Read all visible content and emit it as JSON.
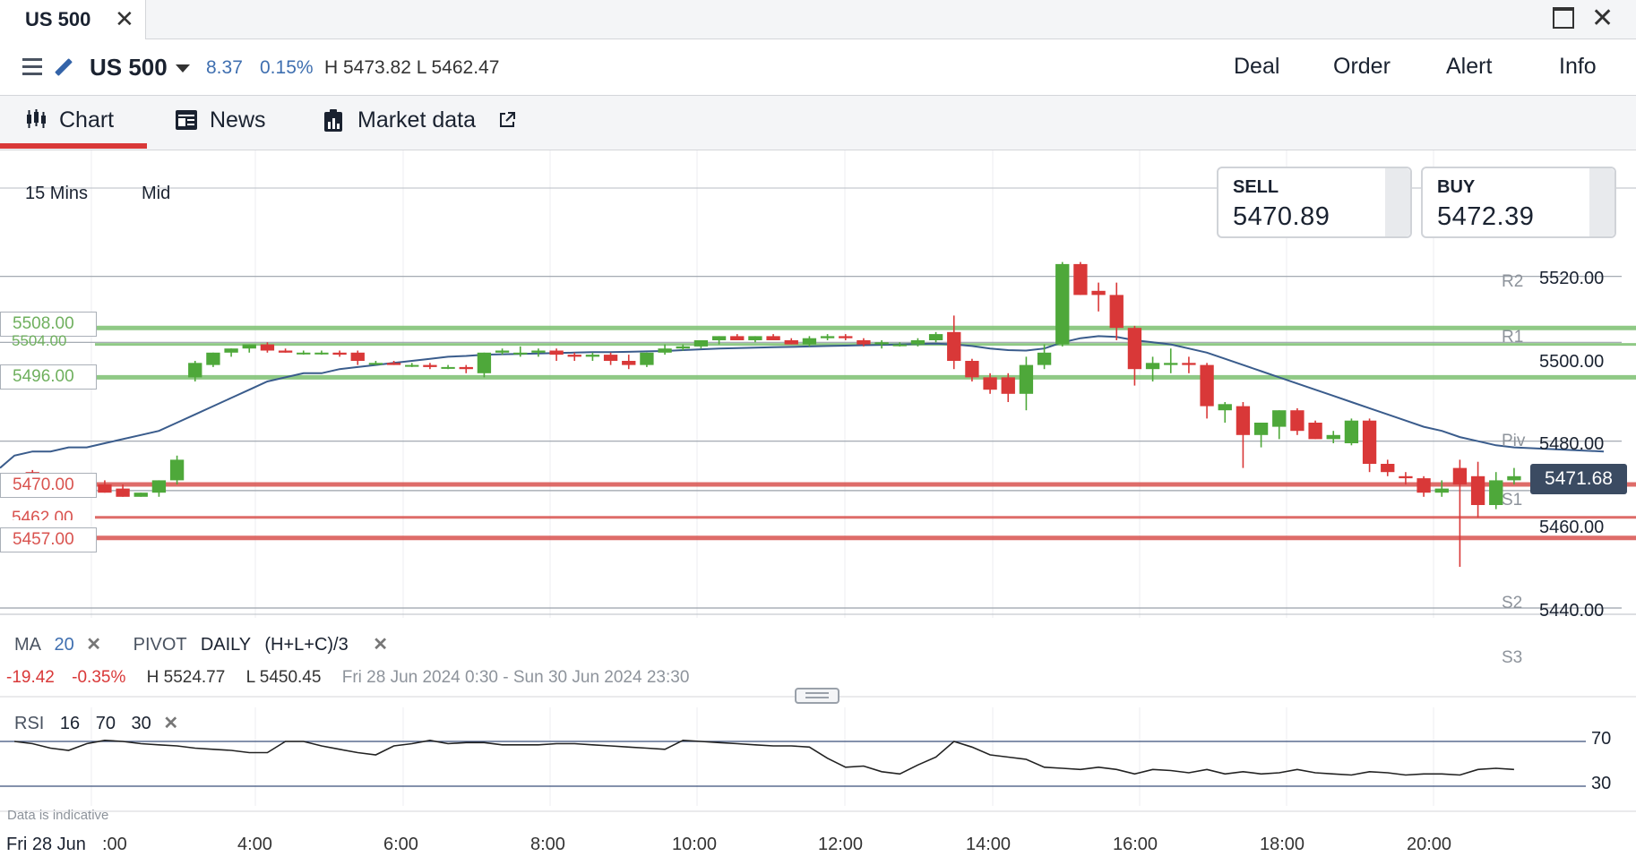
{
  "window": {
    "tab_title": "US 500",
    "close_glyph": "✕",
    "close_win_glyph": "✕"
  },
  "header": {
    "instrument": "US 500",
    "change": "8.37",
    "change_pct": "0.15%",
    "high_low": "H 5473.82  L 5462.47",
    "buttons": [
      "Deal",
      "Order",
      "Alert",
      "Info"
    ]
  },
  "tabs": [
    {
      "label": "Chart",
      "icon": "candlestick-icon",
      "active": true
    },
    {
      "label": "News",
      "icon": "newspaper-icon"
    },
    {
      "label": "Market data",
      "icon": "bar-report-icon",
      "external_icon": "external-link-icon"
    }
  ],
  "chart_controls": {
    "timeframe": "15 Mins",
    "price_type": "Mid"
  },
  "quote": {
    "sell_label": "SELL",
    "sell": "5470.89",
    "buy_label": "BUY",
    "buy": "5472.39",
    "current": "5471.68"
  },
  "levels": {
    "green": [
      "5508.00",
      "5504.00",
      "5496.00"
    ],
    "red": [
      "5470.00",
      "5462.00",
      "5457.00"
    ]
  },
  "pivots": [
    "R2",
    "R1",
    "Piv",
    "S1",
    "S2",
    "S3"
  ],
  "y_axis": [
    "5520.00",
    "5500.00",
    "5480.00",
    "5460.00",
    "5440.00"
  ],
  "studies": {
    "ma_label": "MA",
    "ma_period": "20",
    "ma_remove": "✕",
    "pivot_label": "PIVOT",
    "pivot_period": "DAILY",
    "pivot_formula": "(H+L+C)/3",
    "pivot_remove": "✕"
  },
  "stats": {
    "change": "-19.42",
    "change_pct": "-0.35%",
    "high": "H 5524.77",
    "low": "L 5450.45",
    "range": "Fri 28 Jun 2024 0:30 - Sun 30 Jun 2024 23:30"
  },
  "rsi": {
    "label": "RSI",
    "period": "16",
    "upper": "70",
    "lower": "30",
    "remove": "✕"
  },
  "disclaimer": "Data is indicative",
  "x_axis": {
    "date_label": "Fri 28 Jun",
    "times": [
      ":00",
      "4:00",
      "6:00",
      "8:00",
      "10:00",
      "12:00",
      "14:00",
      "16:00",
      "18:00",
      "20:00"
    ]
  },
  "colors": {
    "up": "#4ea83a",
    "down": "#d93838",
    "ma": "#3a5c8c",
    "rsi": "#222222",
    "support_line": "#d9534f",
    "resistance_line": "#7cc070",
    "accent": "#d93838"
  },
  "chart_data": {
    "type": "candlestick",
    "timeframe": "15 Mins",
    "ylim": [
      5440,
      5530
    ],
    "candles": [
      {
        "o": 5471,
        "h": 5472,
        "l": 5469.5,
        "c": 5472
      },
      {
        "o": 5473,
        "h": 5473.5,
        "l": 5471,
        "c": 5471
      },
      {
        "o": 5471,
        "h": 5472,
        "l": 5470,
        "c": 5471
      },
      {
        "o": 5471,
        "h": 5472,
        "l": 5469,
        "c": 5469
      },
      {
        "o": 5470,
        "h": 5471,
        "l": 5469,
        "c": 5470
      },
      {
        "o": 5470,
        "h": 5471,
        "l": 5468,
        "c": 5468
      },
      {
        "o": 5469,
        "h": 5470,
        "l": 5467,
        "c": 5467
      },
      {
        "o": 5467,
        "h": 5468,
        "l": 5467,
        "c": 5468
      },
      {
        "o": 5468,
        "h": 5471,
        "l": 5467,
        "c": 5471
      },
      {
        "o": 5471,
        "h": 5477,
        "l": 5470,
        "c": 5476
      },
      {
        "o": 5496,
        "h": 5500,
        "l": 5495,
        "c": 5499.5
      },
      {
        "o": 5499,
        "h": 5502,
        "l": 5498.5,
        "c": 5502
      },
      {
        "o": 5502,
        "h": 5503,
        "l": 5501,
        "c": 5503
      },
      {
        "o": 5503,
        "h": 5504,
        "l": 5502,
        "c": 5504
      },
      {
        "o": 5504,
        "h": 5504.5,
        "l": 5502,
        "c": 5502.5
      },
      {
        "o": 5502.5,
        "h": 5503,
        "l": 5502,
        "c": 5502
      },
      {
        "o": 5502,
        "h": 5502.5,
        "l": 5501.5,
        "c": 5502
      },
      {
        "o": 5502,
        "h": 5502.5,
        "l": 5501.5,
        "c": 5502
      },
      {
        "o": 5502,
        "h": 5502.5,
        "l": 5501,
        "c": 5501.5
      },
      {
        "o": 5502,
        "h": 5502.5,
        "l": 5499,
        "c": 5500
      },
      {
        "o": 5499.5,
        "h": 5500,
        "l": 5499,
        "c": 5499.5
      },
      {
        "o": 5499.5,
        "h": 5500,
        "l": 5499,
        "c": 5499
      },
      {
        "o": 5499,
        "h": 5499.5,
        "l": 5498.5,
        "c": 5499
      },
      {
        "o": 5499,
        "h": 5499.5,
        "l": 5498,
        "c": 5498.5
      },
      {
        "o": 5498.5,
        "h": 5499,
        "l": 5498,
        "c": 5498.5
      },
      {
        "o": 5498.5,
        "h": 5499,
        "l": 5497,
        "c": 5498
      },
      {
        "o": 5497,
        "h": 5502,
        "l": 5496,
        "c": 5502
      },
      {
        "o": 5502,
        "h": 5503,
        "l": 5501.5,
        "c": 5502.5
      },
      {
        "o": 5502,
        "h": 5503.5,
        "l": 5501,
        "c": 5502
      },
      {
        "o": 5502,
        "h": 5503,
        "l": 5501,
        "c": 5502.5
      },
      {
        "o": 5502.5,
        "h": 5503,
        "l": 5500,
        "c": 5501.5
      },
      {
        "o": 5501.5,
        "h": 5502,
        "l": 5500,
        "c": 5501
      },
      {
        "o": 5501,
        "h": 5502,
        "l": 5500,
        "c": 5501.5
      },
      {
        "o": 5501.5,
        "h": 5502,
        "l": 5499,
        "c": 5500
      },
      {
        "o": 5500,
        "h": 5501.5,
        "l": 5498,
        "c": 5499
      },
      {
        "o": 5499,
        "h": 5502,
        "l": 5498.5,
        "c": 5502
      },
      {
        "o": 5502,
        "h": 5504,
        "l": 5501.5,
        "c": 5503
      },
      {
        "o": 5503,
        "h": 5504,
        "l": 5502.5,
        "c": 5503.5
      },
      {
        "o": 5503.5,
        "h": 5505,
        "l": 5503,
        "c": 5505
      },
      {
        "o": 5505,
        "h": 5506,
        "l": 5504,
        "c": 5506
      },
      {
        "o": 5506,
        "h": 5506.5,
        "l": 5505,
        "c": 5505
      },
      {
        "o": 5505,
        "h": 5506,
        "l": 5504.5,
        "c": 5506
      },
      {
        "o": 5506,
        "h": 5506.5,
        "l": 5505,
        "c": 5505
      },
      {
        "o": 5505,
        "h": 5505.5,
        "l": 5504,
        "c": 5504
      },
      {
        "o": 5504,
        "h": 5506,
        "l": 5503.5,
        "c": 5505.5
      },
      {
        "o": 5505.5,
        "h": 5506.5,
        "l": 5505,
        "c": 5506
      },
      {
        "o": 5506,
        "h": 5506.5,
        "l": 5505,
        "c": 5505.5
      },
      {
        "o": 5505,
        "h": 5505.5,
        "l": 5503.5,
        "c": 5504
      },
      {
        "o": 5504,
        "h": 5505,
        "l": 5503,
        "c": 5504.5
      },
      {
        "o": 5504,
        "h": 5504.5,
        "l": 5503.5,
        "c": 5504
      },
      {
        "o": 5504,
        "h": 5505.5,
        "l": 5503.5,
        "c": 5505
      },
      {
        "o": 5505,
        "h": 5507,
        "l": 5504.5,
        "c": 5506.5
      },
      {
        "o": 5507,
        "h": 5511,
        "l": 5498,
        "c": 5500
      },
      {
        "o": 5500,
        "h": 5500.5,
        "l": 5495,
        "c": 5496
      },
      {
        "o": 5496,
        "h": 5497,
        "l": 5492,
        "c": 5493
      },
      {
        "o": 5496,
        "h": 5497,
        "l": 5490,
        "c": 5492
      },
      {
        "o": 5492,
        "h": 5501,
        "l": 5488,
        "c": 5499
      },
      {
        "o": 5499,
        "h": 5504,
        "l": 5498,
        "c": 5502
      },
      {
        "o": 5504,
        "h": 5524,
        "l": 5503.5,
        "c": 5523.5
      },
      {
        "o": 5523.5,
        "h": 5524,
        "l": 5516,
        "c": 5516
      },
      {
        "o": 5517,
        "h": 5519,
        "l": 5512,
        "c": 5516
      },
      {
        "o": 5516,
        "h": 5519,
        "l": 5505,
        "c": 5508
      },
      {
        "o": 5508,
        "h": 5508.5,
        "l": 5494,
        "c": 5498
      },
      {
        "o": 5498,
        "h": 5501,
        "l": 5495,
        "c": 5499.5
      },
      {
        "o": 5499,
        "h": 5503,
        "l": 5497,
        "c": 5499.5
      },
      {
        "o": 5499.5,
        "h": 5501,
        "l": 5497,
        "c": 5499
      },
      {
        "o": 5499,
        "h": 5499.5,
        "l": 5486,
        "c": 5489
      },
      {
        "o": 5488,
        "h": 5490,
        "l": 5485,
        "c": 5489.5
      },
      {
        "o": 5489,
        "h": 5490,
        "l": 5474,
        "c": 5482
      },
      {
        "o": 5482,
        "h": 5484,
        "l": 5479,
        "c": 5485
      },
      {
        "o": 5484,
        "h": 5488,
        "l": 5481,
        "c": 5488
      },
      {
        "o": 5488,
        "h": 5488.5,
        "l": 5482,
        "c": 5483
      },
      {
        "o": 5485,
        "h": 5485.5,
        "l": 5481,
        "c": 5481
      },
      {
        "o": 5481,
        "h": 5483,
        "l": 5480,
        "c": 5482
      },
      {
        "o": 5480,
        "h": 5486,
        "l": 5479.5,
        "c": 5485.5
      },
      {
        "o": 5485.5,
        "h": 5486,
        "l": 5473,
        "c": 5475
      },
      {
        "o": 5475,
        "h": 5476,
        "l": 5472,
        "c": 5473
      },
      {
        "o": 5472,
        "h": 5473,
        "l": 5470,
        "c": 5471.5
      },
      {
        "o": 5471.5,
        "h": 5472,
        "l": 5467,
        "c": 5468
      },
      {
        "o": 5468,
        "h": 5471,
        "l": 5467,
        "c": 5469
      },
      {
        "o": 5474,
        "h": 5476,
        "l": 5450,
        "c": 5470
      },
      {
        "o": 5472,
        "h": 5475.5,
        "l": 5462,
        "c": 5465
      },
      {
        "o": 5465,
        "h": 5473,
        "l": 5464,
        "c": 5471
      },
      {
        "o": 5471,
        "h": 5474,
        "l": 5470,
        "c": 5472
      }
    ],
    "ma20": [
      5477,
      5478,
      5478,
      5479,
      5479,
      5480,
      5481,
      5482,
      5483,
      5485,
      5487,
      5489,
      5491,
      5493,
      5495,
      5496,
      5497,
      5497,
      5498,
      5498.5,
      5499,
      5499.5,
      5500,
      5500.5,
      5501,
      5501.2,
      5501.5,
      5501.6,
      5501.7,
      5501.8,
      5501.9,
      5502,
      5502.1,
      5502.1,
      5502.2,
      5502.3,
      5502.4,
      5502.6,
      5502.8,
      5503,
      5503.1,
      5503.2,
      5503.3,
      5503.4,
      5503.5,
      5503.6,
      5503.7,
      5503.8,
      5503.9,
      5504,
      5504.1,
      5504.2,
      5504,
      5503.6,
      5503,
      5502.6,
      5502.5,
      5503,
      5504.5,
      5505.5,
      5506,
      5505.8,
      5505,
      5504.5,
      5504,
      5503,
      5502,
      5500.5,
      5499,
      5497.5,
      5496,
      5494.5,
      5493,
      5491.5,
      5490,
      5488.5,
      5487,
      5485.5,
      5484,
      5483,
      5481.5,
      5480.5,
      5479.5,
      5479
    ],
    "rsi": [
      70,
      68,
      64,
      62,
      68,
      71,
      70,
      68,
      67,
      66,
      64,
      63,
      62,
      60,
      60,
      70,
      70,
      66,
      63,
      60,
      58,
      66,
      68,
      71,
      68,
      69,
      69,
      67,
      67,
      67,
      68,
      68,
      67,
      66,
      65,
      64,
      63,
      71,
      70,
      69,
      68,
      67,
      66,
      66,
      65,
      55,
      47,
      48,
      43,
      41,
      49,
      56,
      70,
      65,
      58,
      56,
      54,
      47,
      46,
      45,
      47,
      45,
      41,
      45,
      44,
      42,
      45,
      41,
      43,
      41,
      42,
      45,
      42,
      41,
      40,
      43,
      42,
      40,
      41,
      41,
      40,
      45,
      46,
      45
    ],
    "y_axis_ticks": [
      5440,
      5460,
      5480,
      5500,
      5520
    ],
    "x_axis_ticks": [
      ":00",
      "4:00",
      "6:00",
      "8:00",
      "10:00",
      "12:00",
      "14:00",
      "16:00",
      "18:00",
      "20:00"
    ],
    "horizontal_levels": {
      "resistance": [
        5508,
        5504,
        5496
      ],
      "support": [
        5470,
        5462,
        5457
      ]
    },
    "pivot_levels": {
      "R2": 5520.5,
      "R1": 5504.5,
      "Piv": 5480.5,
      "S1": 5468.5,
      "S2": 5440,
      "S3": 5431
    },
    "rsi_bands": [
      70,
      30
    ]
  }
}
